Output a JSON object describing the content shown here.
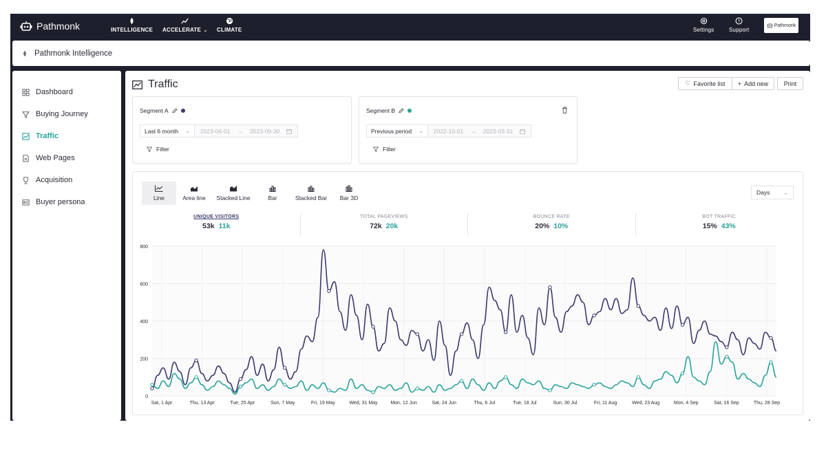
{
  "colors": {
    "navy": "#1e1f2c",
    "series_a": "#3b3a6e",
    "series_b": "#2aa39a",
    "active": "#2aa39a"
  },
  "topnav": {
    "brand": "Pathmonk",
    "items": [
      {
        "label": "INTELLIGENCE",
        "icon": "leaf-icon"
      },
      {
        "label": "ACCELERATE",
        "icon": "trend-icon"
      },
      {
        "label": "CLIMATE",
        "icon": "globe-icon"
      }
    ],
    "settings": "Settings",
    "support": "Support",
    "logo_text": "Pathmonk"
  },
  "subheader": {
    "title": "Pathmonk Intelligence"
  },
  "sidebar": {
    "items": [
      {
        "label": "Dashboard",
        "icon": "grid-icon",
        "active": false
      },
      {
        "label": "Buying Journey",
        "icon": "funnel-icon",
        "active": false
      },
      {
        "label": "Traffic",
        "icon": "chart-icon",
        "active": true
      },
      {
        "label": "Web Pages",
        "icon": "page-icon",
        "active": false
      },
      {
        "label": "Acquisition",
        "icon": "trophy-icon",
        "active": false
      },
      {
        "label": "Buyer persona",
        "icon": "id-card-icon",
        "active": false
      }
    ]
  },
  "main": {
    "title": "Traffic",
    "favorite_label": "Favorite list",
    "add_label": "Add new",
    "print_label": "Print"
  },
  "segments": {
    "a": {
      "label": "Segment A",
      "period": "Last 6 month",
      "start": "2023-04-01",
      "end": "2023-09-30",
      "filter": "Filter",
      "color": "#3b3a6e"
    },
    "b": {
      "label": "Segment B",
      "period": "Previous period",
      "start": "2022-10-01",
      "end": "2023-03-31",
      "filter": "Filter",
      "color": "#2aa39a"
    }
  },
  "chart_types": [
    "Line",
    "Area line",
    "Stacked Line",
    "Bar",
    "Stacked Bar",
    "Bar 3D"
  ],
  "active_chart_type": "Line",
  "granularity": "Days",
  "kpis": [
    {
      "title": "UNIQUE VISITORS",
      "a": "53k",
      "b": "11k",
      "active": true
    },
    {
      "title": "TOTAL PAGEVIEWS",
      "a": "72k",
      "b": "20k",
      "active": false
    },
    {
      "title": "BOUNCE RATE",
      "a": "20%",
      "b": "10%",
      "active": false
    },
    {
      "title": "BOT TRAFFIC",
      "a": "15%",
      "b": "43%",
      "active": false
    }
  ],
  "chart_data": {
    "type": "line",
    "title": "",
    "xlabel": "",
    "ylabel": "",
    "ylim": [
      0,
      800
    ],
    "yticks": [
      0,
      200,
      400,
      600,
      800
    ],
    "x_tick_labels": [
      "Sat, 1 Apr",
      "Thu, 13 Apr",
      "Tue, 25 Apr",
      "Sun, 7 May",
      "Fri, 19 May",
      "Wed, 31 May",
      "Mon, 12 Jun",
      "Sat, 24 Jun",
      "Thu, 6 Jul",
      "Tue, 18 Jul",
      "Sun, 30 Jul",
      "Fri, 11 Aug",
      "Wed, 23 Aug",
      "Mon, 4 Sep",
      "Sat, 16 Sep",
      "Thu, 28 Sep"
    ],
    "grid": true,
    "series": [
      {
        "values": [
          40,
          110,
          150,
          90,
          180,
          130,
          60,
          150,
          190,
          120,
          80,
          110,
          160,
          120,
          70,
          20,
          90,
          140,
          210,
          110,
          170,
          80,
          140,
          260,
          150,
          90,
          130,
          250,
          320,
          290,
          420,
          780,
          560,
          610,
          450,
          350,
          540,
          430,
          300,
          490,
          370,
          240,
          280,
          470,
          400,
          300,
          270,
          350,
          330,
          240,
          300,
          190,
          400,
          270,
          110,
          240,
          330,
          390,
          300,
          200,
          380,
          580,
          510,
          460,
          340,
          540,
          340,
          430,
          310,
          220,
          470,
          380,
          580,
          420,
          340,
          450,
          480,
          540,
          500,
          380,
          430,
          450,
          520,
          460,
          520,
          440,
          460,
          630,
          480,
          430,
          400,
          420,
          350,
          470,
          360,
          480,
          380,
          420,
          280,
          350,
          400,
          330,
          320,
          290,
          260,
          340,
          300,
          220,
          310,
          280,
          250,
          340,
          310,
          240
        ]
      },
      {
        "values": [
          60,
          40,
          80,
          50,
          120,
          90,
          40,
          70,
          100,
          60,
          30,
          50,
          80,
          60,
          40,
          10,
          50,
          70,
          90,
          40,
          60,
          30,
          50,
          90,
          60,
          40,
          50,
          80,
          30,
          60,
          40,
          70,
          30,
          20,
          40,
          30,
          90,
          40,
          60,
          30,
          20,
          50,
          40,
          60,
          30,
          40,
          70,
          20,
          40,
          30,
          50,
          20,
          60,
          30,
          40,
          60,
          80,
          40,
          90,
          60,
          30,
          70,
          40,
          80,
          100,
          60,
          40,
          90,
          70,
          60,
          80,
          40,
          30,
          60,
          50,
          40,
          70,
          60,
          50,
          40,
          60,
          70,
          50,
          40,
          60,
          80,
          70,
          50,
          100,
          60,
          40,
          80,
          90,
          130,
          110,
          70,
          120,
          210,
          100,
          80,
          60,
          130,
          290,
          170,
          210,
          180,
          90,
          120,
          90,
          70,
          50,
          110,
          180,
          100
        ]
      }
    ]
  }
}
